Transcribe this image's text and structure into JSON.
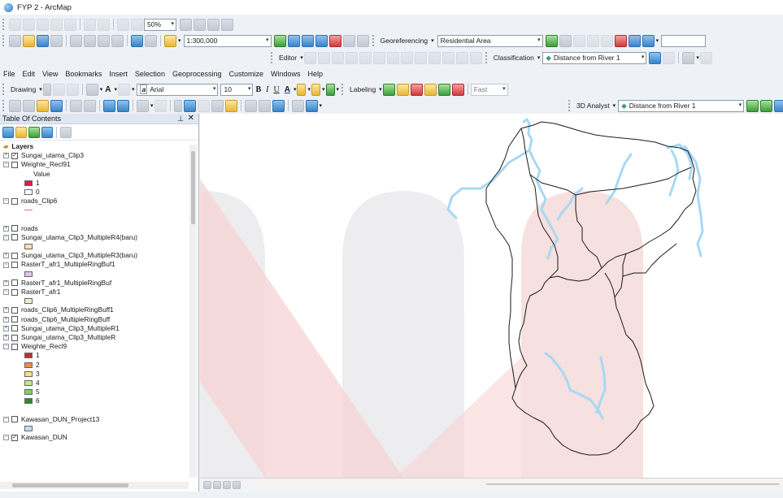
{
  "window": {
    "title": "FYP 2 - ArcMap"
  },
  "toolbar_standard": {
    "zoom_percent": "50%",
    "scale": "1:300,000",
    "georeferencing_label": "Georeferencing",
    "georeferencing_layer": "Residential Area"
  },
  "toolbar_editor": {
    "editor_label": "Editor",
    "classification_label": "Classification",
    "classification_layer": "Distance from River 1"
  },
  "menu": [
    "File",
    "Edit",
    "View",
    "Bookmarks",
    "Insert",
    "Selection",
    "Geoprocessing",
    "Customize",
    "Windows",
    "Help"
  ],
  "toolbar_drawing": {
    "drawing_label": "Drawing",
    "font": "Arial",
    "font_size": "10",
    "bold": "B",
    "italic": "I",
    "underline": "U",
    "text_icon": "A",
    "labeling_label": "Labeling",
    "labeling_speed": "Fast"
  },
  "toolbar_tools": {
    "analyst_label": "3D Analyst",
    "analyst_layer": "Distance from River 1"
  },
  "toc": {
    "title": "Table Of Contents",
    "root": "Layers",
    "value_heading": "Value",
    "layers": [
      {
        "name": "Sungai_utama_Clip3",
        "checked": true,
        "expanded": false
      },
      {
        "name": "Weighte_Recl91",
        "checked": false,
        "expanded": true,
        "legend": [
          {
            "label": "1",
            "color": "#e8174d"
          },
          {
            "label": "0",
            "color": "#ffffff"
          }
        ]
      },
      {
        "name": "roads_Clip6",
        "checked": false,
        "expanded": true,
        "line_color": "#e36b6b"
      },
      {
        "name": "roads",
        "checked": false,
        "expanded": false
      },
      {
        "name": "Sungai_utama_Clip3_MultipleR4(baru)",
        "checked": false,
        "expanded": true,
        "swatch": "#f3e2b5"
      },
      {
        "name": "Sungai_utama_Clip3_MultipleR3(baru)",
        "checked": false,
        "expanded": false
      },
      {
        "name": "RasterT_afr1_MultipleRingBuf1",
        "checked": false,
        "expanded": true,
        "swatch": "#dcc6ec"
      },
      {
        "name": "RasterT_afr1_MultipleRingBuf",
        "checked": false,
        "expanded": false
      },
      {
        "name": "RasterT_afr1",
        "checked": false,
        "expanded": true,
        "swatch": "#e8f2c9"
      },
      {
        "name": "roads_Clip6_MultipleRingBuff1",
        "checked": false,
        "expanded": false
      },
      {
        "name": "roads_Clip6_MultipleRingBuff",
        "checked": false,
        "expanded": false
      },
      {
        "name": "Sungai_utama_Clip3_MultipleR1",
        "checked": false,
        "expanded": false
      },
      {
        "name": "Sungai_utama_Clip3_MultipleR",
        "checked": false,
        "expanded": false
      },
      {
        "name": "Weighte_Recl9",
        "checked": false,
        "expanded": true,
        "legend": [
          {
            "label": "1",
            "color": "#c0302a"
          },
          {
            "label": "2",
            "color": "#ee8a4a"
          },
          {
            "label": "3",
            "color": "#f7df8f"
          },
          {
            "label": "4",
            "color": "#c9e58e"
          },
          {
            "label": "5",
            "color": "#7fce6a"
          },
          {
            "label": "6",
            "color": "#2e8b2e"
          }
        ]
      },
      {
        "name": "Kawasan_DUN_Project13",
        "checked": false,
        "expanded": true,
        "swatch": "#c6d8f2"
      },
      {
        "name": "Kawasan_DUN",
        "checked": true,
        "expanded": false
      }
    ]
  },
  "colors": {
    "river": "#a7d8f5",
    "boundary": "#1a1a1a",
    "watermark_red": "#f6cfcf",
    "watermark_grey": "#ececee"
  }
}
